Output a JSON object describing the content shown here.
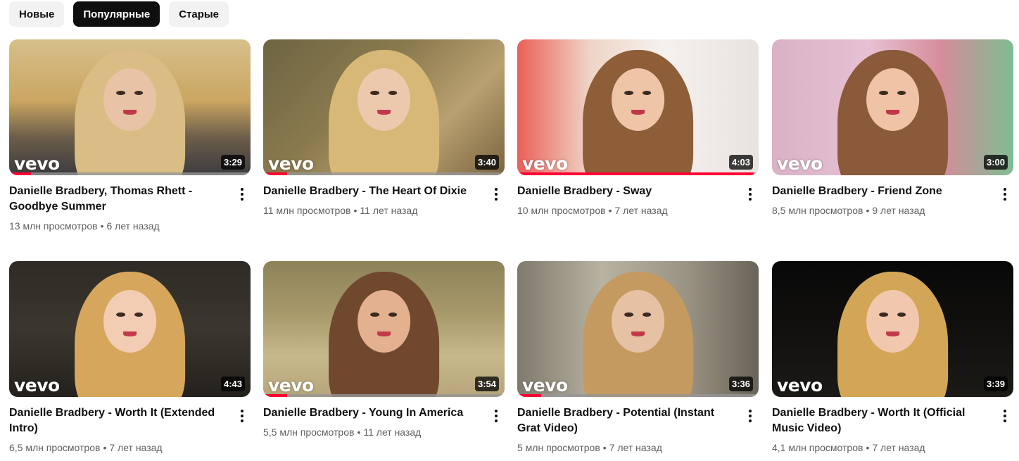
{
  "filters": {
    "items": [
      {
        "label": "Новые",
        "active": false
      },
      {
        "label": "Популярные",
        "active": true
      },
      {
        "label": "Старые",
        "active": false
      }
    ]
  },
  "videos": [
    {
      "title": "Danielle Bradbery, Thomas Rhett - Goodbye Summer",
      "views": "13 млн просмотров",
      "age": "6 лет назад",
      "duration": "3:29",
      "watched": 0.09,
      "bg": "linear-gradient(180deg,#d7c08a 0%,#caa661 45%,#6d5e4a 72%,#3b3b3e 100%)",
      "hair": "#d9bd85",
      "skin": "#e8c3a5"
    },
    {
      "title": "Danielle Bradbery - The Heart Of Dixie",
      "views": "11 млн просмотров",
      "age": "11 лет назад",
      "duration": "3:40",
      "watched": 0.1,
      "bg": "linear-gradient(135deg,#6e6543 0%,#8a7a4e 40%,#b9a070 70%,#7a6440 100%)",
      "hair": "#d8b877",
      "skin": "#ecc9ac"
    },
    {
      "title": "Danielle Bradbery - Sway",
      "views": "10 млн просмотров",
      "age": "7 лет назад",
      "duration": "4:03",
      "watched": 0.98,
      "bg": "linear-gradient(90deg,#e96058 0%,#efd4c6 30%,#f5f1ee 60%,#e9e3e0 100%)",
      "hair": "#8e5e38",
      "skin": "#efc5a8"
    },
    {
      "title": "Danielle Bradbery - Friend Zone",
      "views": "8,5 млн просмотров",
      "age": "9 лет назад",
      "duration": "3:00",
      "watched": 0,
      "bg": "linear-gradient(90deg,#d9b3c5 0%,#e6c1d3 40%,#d68c9a 70%,#7dbd93 100%)",
      "hair": "#8a5a3a",
      "skin": "#f0c2a6"
    },
    {
      "title": "Danielle Bradbery - Worth It (Extended Intro)",
      "views": "6,5 млн просмотров",
      "age": "7 лет назад",
      "duration": "4:43",
      "watched": 0,
      "bg": "linear-gradient(180deg,#2e2a25 0%,#3b362f 50%,#24211d 100%)",
      "hair": "#d6a65c",
      "skin": "#f2cdb3"
    },
    {
      "title": "Danielle Bradbery - Young In America",
      "views": "5,5 млн просмотров",
      "age": "11 лет назад",
      "duration": "3:54",
      "watched": 0.1,
      "bg": "linear-gradient(180deg,#8d8258 0%,#a99a6c 40%,#c7b88c 70%,#b6a57a 100%)",
      "hair": "#70482e",
      "skin": "#e3b190"
    },
    {
      "title": "Danielle Bradbery - Potential (Instant Grat Video)",
      "views": "5 млн просмотров",
      "age": "7 лет назад",
      "duration": "3:36",
      "watched": 0.1,
      "bg": "linear-gradient(90deg,#7f7a6d 0%,#b8b2a1 35%,#9a9384 70%,#6a6458 100%)",
      "hair": "#c59a61",
      "skin": "#e6c1a4"
    },
    {
      "title": "Danielle Bradbery - Worth It (Official Music Video)",
      "views": "4,1 млн просмотров",
      "age": "7 лет назад",
      "duration": "3:39",
      "watched": 0,
      "bg": "linear-gradient(180deg,#080808 0%,#141210 60%,#1c1a17 100%)",
      "hair": "#d3a657",
      "skin": "#f1c8ad"
    }
  ],
  "logo_text": "vevo"
}
